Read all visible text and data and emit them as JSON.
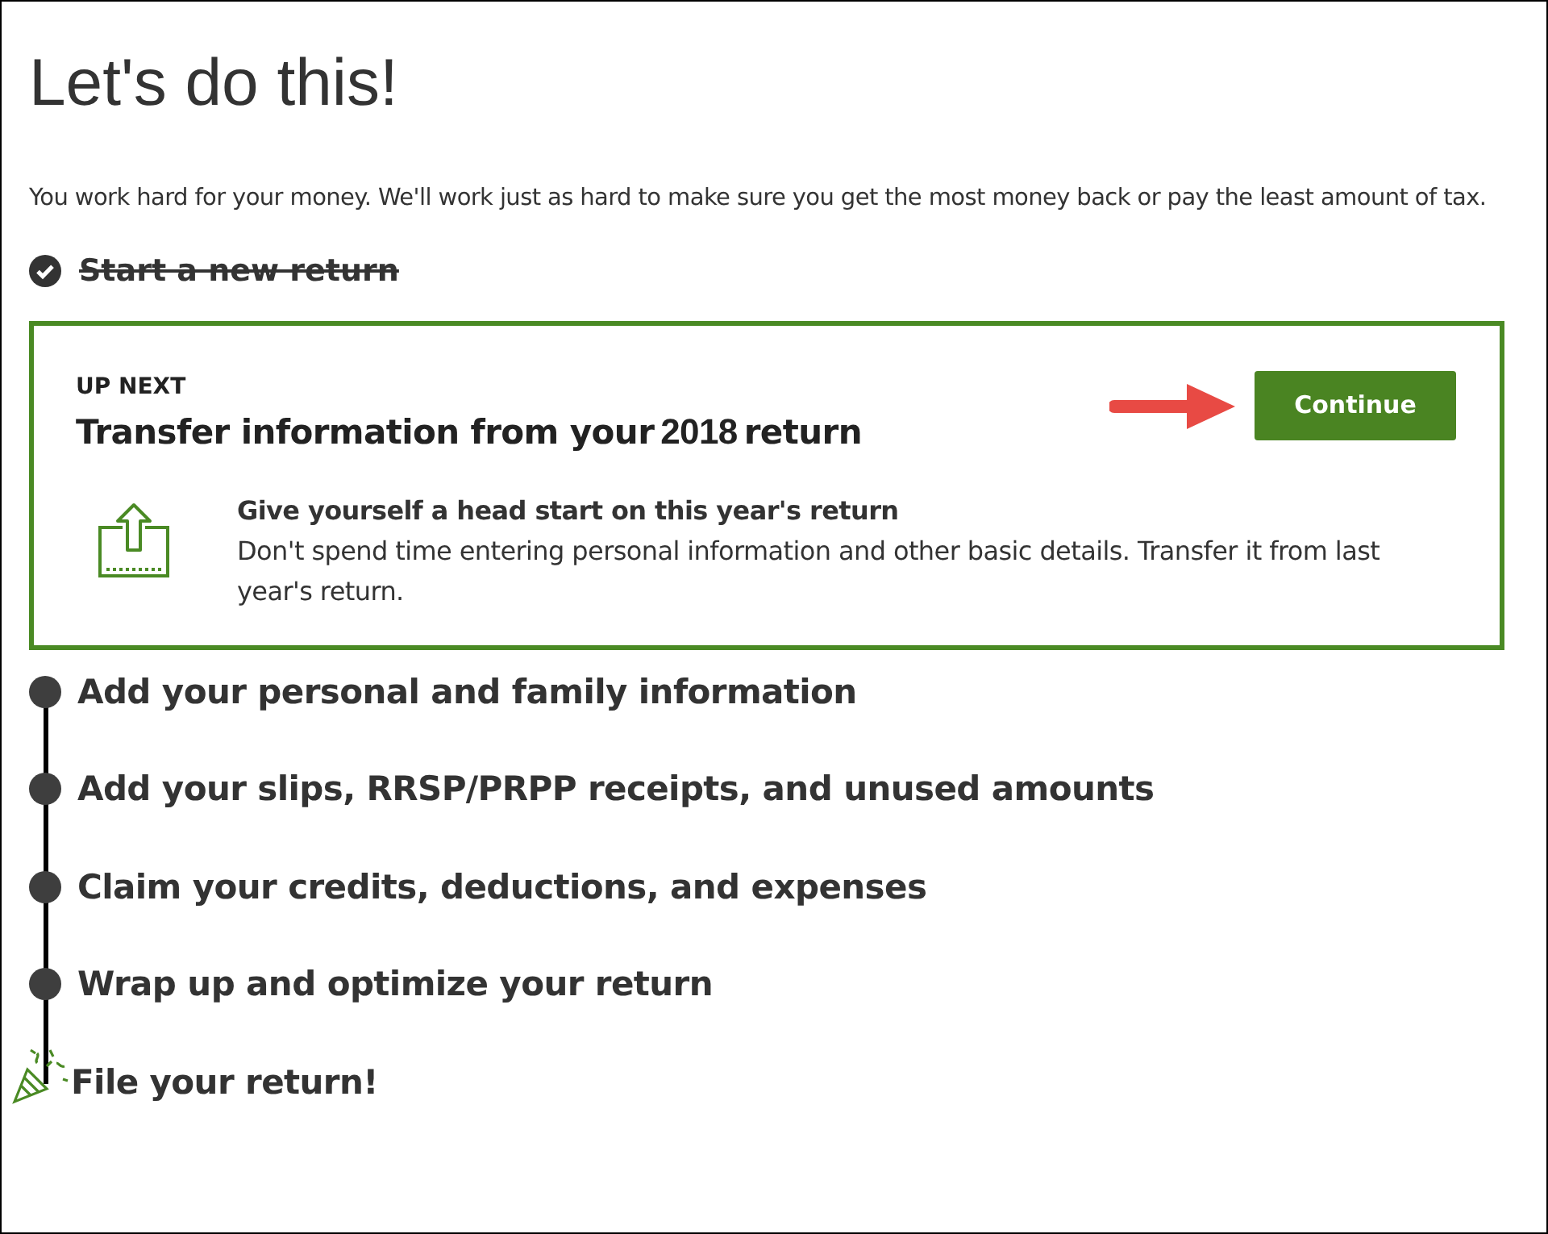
{
  "heading": "Let's do this!",
  "intro": "You work hard for your money. We'll work just as hard to make sure you get the most money back or pay the least amount of tax.",
  "completed_steps": [
    {
      "label": "Start a new return",
      "done": true
    }
  ],
  "up_next": {
    "eyebrow": "UP NEXT",
    "title": "Transfer information from your",
    "year": "2018",
    "title_end": "return",
    "button": "Continue",
    "subtitle": "Give yourself a head start on this year's return",
    "body": "Don't spend time entering personal information and other basic details. Transfer it from last year's return."
  },
  "remaining_steps": [
    {
      "label": "Add your personal and family information",
      "kind": "dot"
    },
    {
      "label": "Add your slips, RRSP/PRPP receipts, and unused amounts",
      "kind": "dot"
    },
    {
      "label": "Claim your credits, deductions, and expenses",
      "kind": "dot"
    },
    {
      "label": "Wrap up and optimize your return",
      "kind": "dot"
    },
    {
      "label": "File your return!",
      "kind": "finish"
    }
  ]
}
